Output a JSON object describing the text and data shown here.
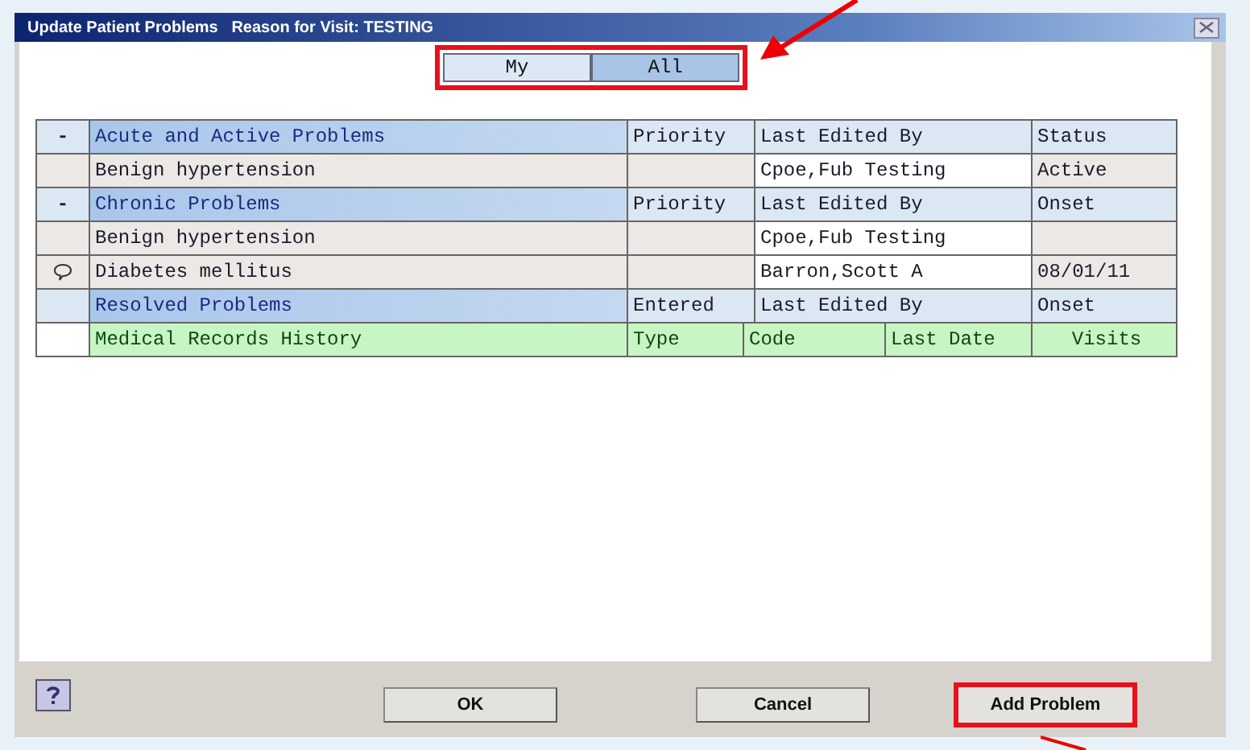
{
  "window": {
    "title": "Update Patient Problems   Reason for Visit: TESTING"
  },
  "tabs": [
    {
      "label": "My",
      "selected": false
    },
    {
      "label": "All",
      "selected": true
    }
  ],
  "problem_table": {
    "rows": [
      {
        "kind": "group",
        "toggle": "-",
        "title": "Acute and Active Problems",
        "columns": [
          "Priority",
          "Last Edited By",
          "Status"
        ]
      },
      {
        "kind": "problem",
        "note": false,
        "name": "Benign hypertension",
        "edited_by": "Cpoe,Fub Testing",
        "status": "Active"
      },
      {
        "kind": "group",
        "toggle": "-",
        "title": "Chronic Problems",
        "columns": [
          "Priority",
          "Last Edited By",
          "Onset"
        ]
      },
      {
        "kind": "problem",
        "note": false,
        "name": "Benign hypertension",
        "edited_by": "Cpoe,Fub Testing"
      },
      {
        "kind": "problem",
        "note": true,
        "name": "Diabetes mellitus",
        "edited_by": "Barron,Scott A",
        "status": "08/01/11"
      },
      {
        "kind": "group",
        "title": "Resolved Problems",
        "columns": [
          "Entered",
          "Last Edited By",
          "Onset"
        ]
      },
      {
        "kind": "history",
        "title": "Medical Records History",
        "columns": [
          "Type",
          "Code",
          "Last Date",
          "Visits"
        ]
      }
    ]
  },
  "buttons": [
    {
      "label": "OK",
      "highlighted": false
    },
    {
      "label": "Cancel",
      "highlighted": false
    },
    {
      "label": "Add Problem",
      "highlighted": true
    }
  ]
}
